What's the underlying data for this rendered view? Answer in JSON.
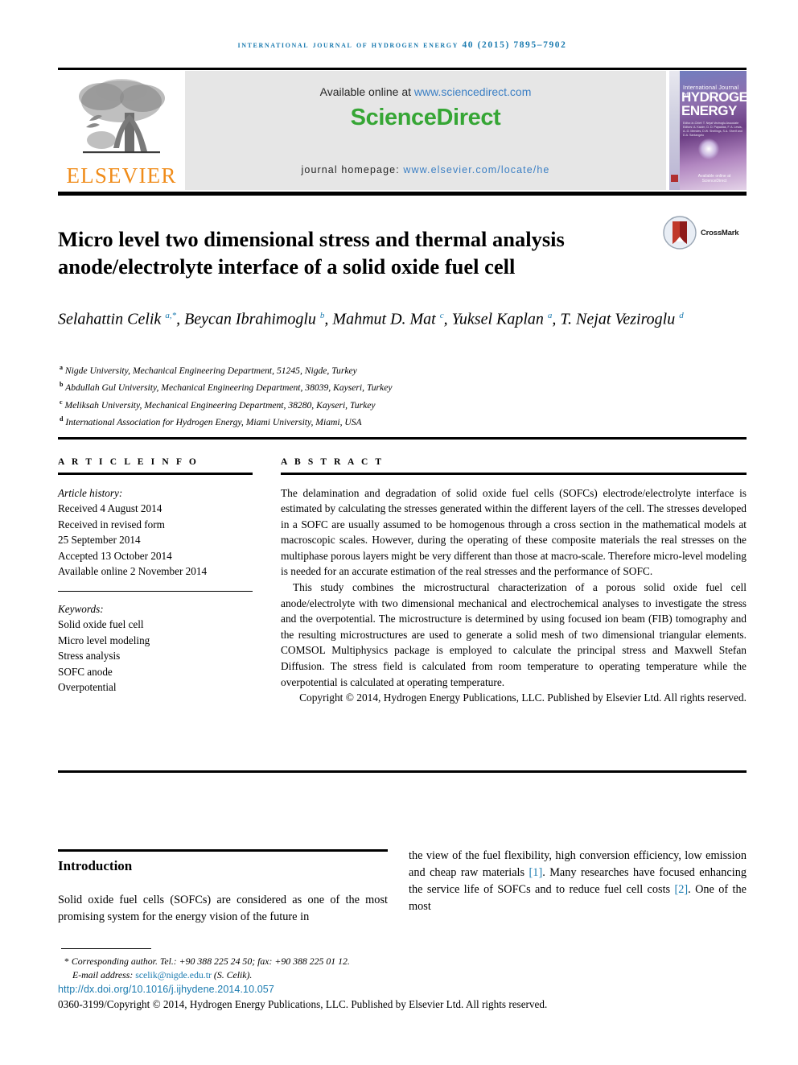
{
  "running_head": "International Journal of Hydrogen Energy 40 (2015) 7895–7902",
  "header": {
    "publisher_name": "ELSEVIER",
    "publisher_logo_icon": "elsevier-tree-icon",
    "available_prefix": "Available online at ",
    "available_url": "www.sciencedirect.com",
    "sciencedirect_logo": "ScienceDirect",
    "homepage_label": "journal homepage: ",
    "homepage_url": "www.elsevier.com/locate/he",
    "cover": {
      "line1": "International Journal of",
      "line2": "HYDROGEN",
      "line3": "ENERGY",
      "editors": "Editor-in-Chief: T. Nejat Veziroglu\nAssociate Editors: A. Kazim, D. D. Papadias, F. A. Lewis,\nA.-G. Mendes, D.W. Shellings,\nS.A. Sherif and D.A. Santangelo",
      "sciencedirect_mark": "Available online at ScienceDirect"
    }
  },
  "article": {
    "title": "Micro level two dimensional stress and thermal analysis anode/electrolyte interface of a solid oxide fuel cell",
    "crossmark_label": "CrossMark",
    "crossmark_icon": "crossmark-icon",
    "authors_html": "Selahattin Celik <sup>a,*</sup>, Beycan Ibrahimoglu <sup>b</sup>, Mahmut D. Mat <sup>c</sup>, Yuksel Kaplan <sup>a</sup>, T. Nejat Veziroglu <sup>d</sup>",
    "affiliations": [
      {
        "mark": "a",
        "text": "Nigde University, Mechanical Engineering Department, 51245, Nigde, Turkey"
      },
      {
        "mark": "b",
        "text": "Abdullah Gul University, Mechanical Engineering Department, 38039, Kayseri, Turkey"
      },
      {
        "mark": "c",
        "text": "Meliksah University, Mechanical Engineering Department, 38280, Kayseri, Turkey"
      },
      {
        "mark": "d",
        "text": "International Association for Hydrogen Energy, Miami University, Miami, USA"
      }
    ]
  },
  "article_info": {
    "heading": "A R T I C L E  I N F O",
    "history_label": "Article history:",
    "history": [
      "Received 4 August 2014",
      "Received in revised form",
      "25 September 2014",
      "Accepted 13 October 2014",
      "Available online 2 November 2014"
    ],
    "keywords_label": "Keywords:",
    "keywords": [
      "Solid oxide fuel cell",
      "Micro level modeling",
      "Stress analysis",
      "SOFC anode",
      "Overpotential"
    ]
  },
  "abstract": {
    "heading": "A B S T R A C T",
    "paragraph1": "The delamination and degradation of solid oxide fuel cells (SOFCs) electrode/electrolyte interface is estimated by calculating the stresses generated within the different layers of the cell. The stresses developed in a SOFC are usually assumed to be homogenous through a cross section in the mathematical models at macroscopic scales. However, during the operating of these composite materials the real stresses on the multiphase porous layers might be very different than those at macro-scale. Therefore micro-level modeling is needed for an accurate estimation of the real stresses and the performance of SOFC.",
    "paragraph2": "This study combines the microstructural characterization of a porous solid oxide fuel cell anode/electrolyte with two dimensional mechanical and electrochemical analyses to investigate the stress and the overpotential. The microstructure is determined by using focused ion beam (FIB) tomography and the resulting microstructures are used to generate a solid mesh of two dimensional triangular elements. COMSOL Multiphysics package is employed to calculate the principal stress and Maxwell Stefan Diffusion. The stress field is calculated from room temperature to operating temperature while the overpotential is calculated at operating temperature.",
    "copyright": "Copyright © 2014, Hydrogen Energy Publications, LLC. Published by Elsevier Ltd. All rights reserved."
  },
  "introduction": {
    "heading": "Introduction",
    "left_text": "Solid oxide fuel cells (SOFCs) are considered as one of the most promising system for the energy vision of the future in",
    "right_part1": "the view of the fuel flexibility, high conversion efficiency, low emission and cheap raw materials ",
    "right_cite1": "[1]",
    "right_part2": ". Many researches have focused enhancing the service life of SOFCs and to reduce fuel cell costs ",
    "right_cite2": "[2]",
    "right_part3": ". One of the most"
  },
  "footer": {
    "corresponding_star": "*",
    "corresponding_text": "Corresponding author. Tel.: +90 388 225 24 50; fax: +90 388 225 01 12.",
    "email_label": "E-mail address: ",
    "email": "scelik@nigde.edu.tr",
    "email_suffix": " (S. Celik).",
    "doi": "http://dx.doi.org/10.1016/j.ijhydene.2014.10.057",
    "issn_copyright": "0360-3199/Copyright © 2014, Hydrogen Energy Publications, LLC. Published by Elsevier Ltd. All rights reserved."
  },
  "colors": {
    "link_blue": "#1b7bb0",
    "sciencedirect_green": "#36a635",
    "elsevier_orange": "#f08c1a",
    "header_band_gray": "#e6e6e6"
  }
}
